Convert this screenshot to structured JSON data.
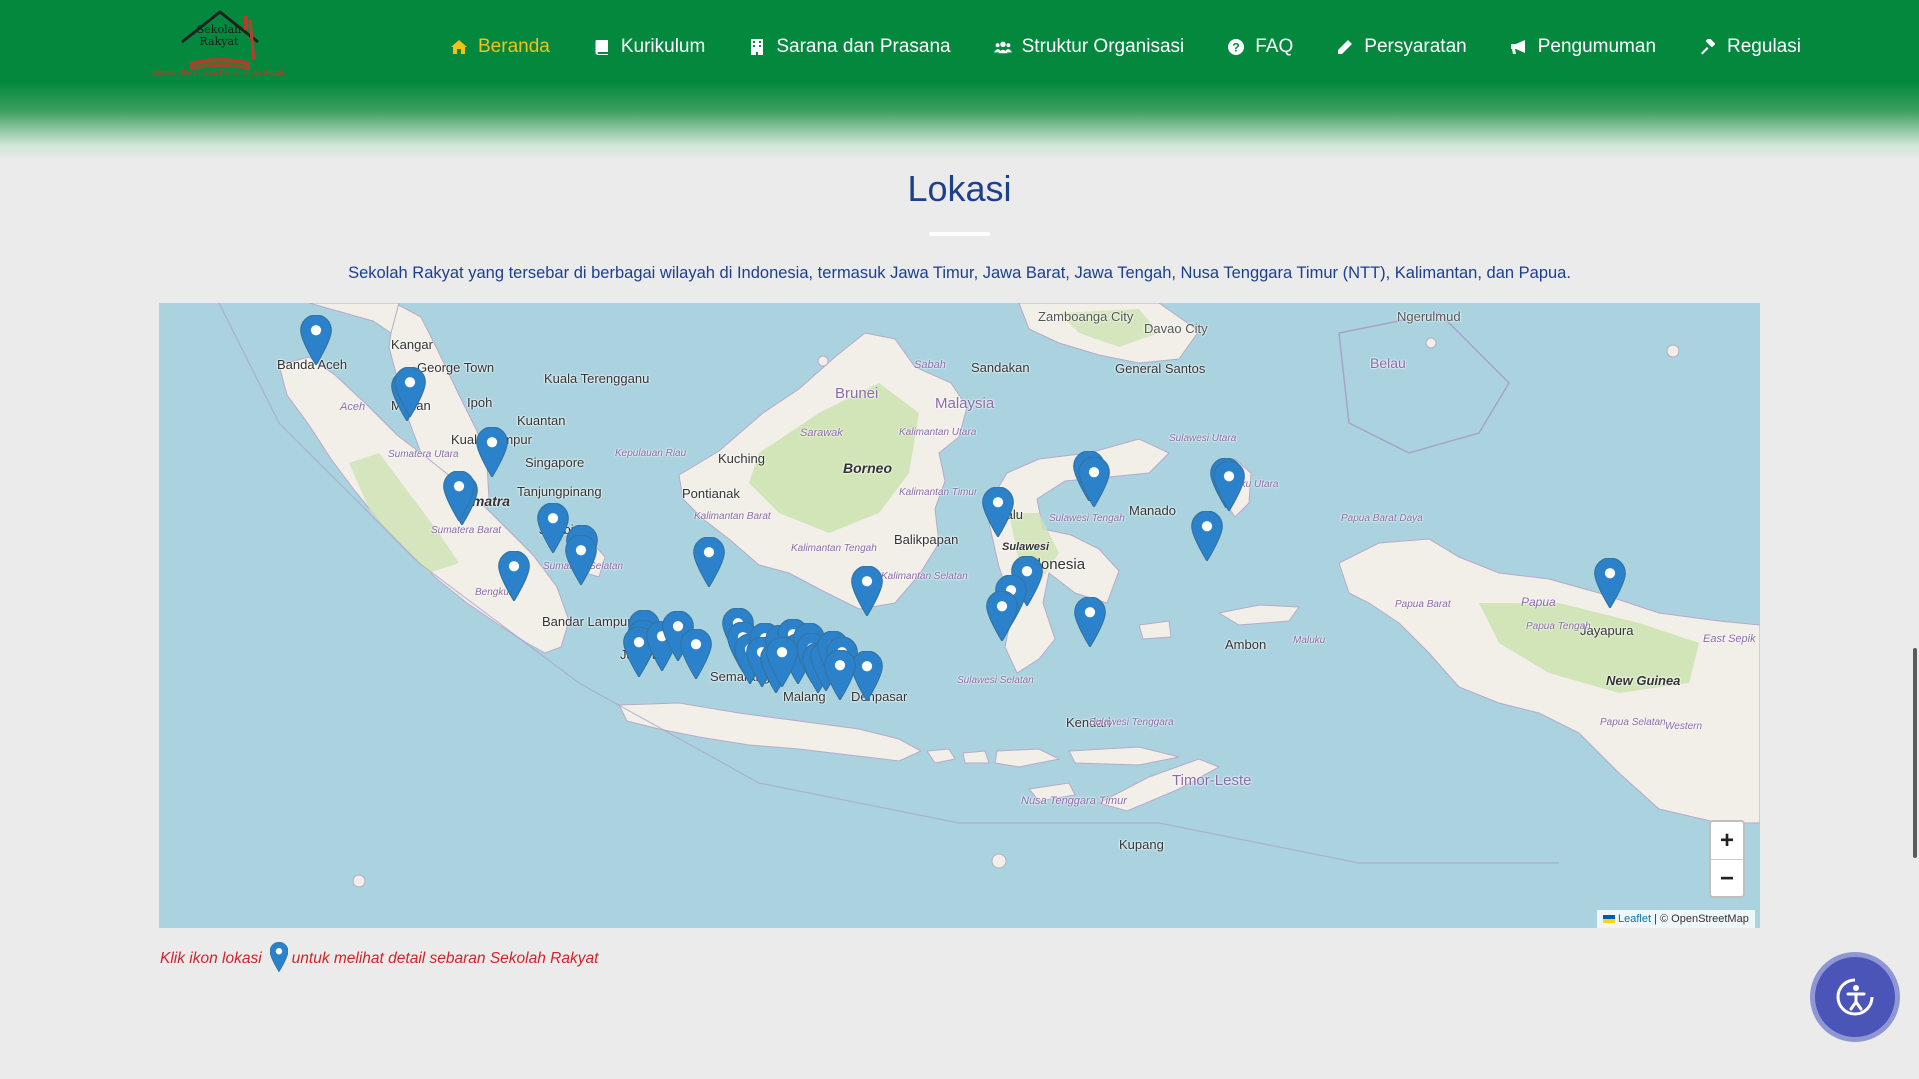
{
  "logo": {
    "title_line1": "Sekolah",
    "title_line2": "Rakyat",
    "tagline": "Sekolah Berasrama Kementerian Sosial"
  },
  "nav": {
    "items": [
      {
        "label": "Beranda",
        "icon": "home-icon",
        "active": true
      },
      {
        "label": "Kurikulum",
        "icon": "book-icon",
        "active": false
      },
      {
        "label": "Sarana dan Prasana",
        "icon": "building-icon",
        "active": false
      },
      {
        "label": "Struktur Organisasi",
        "icon": "users-icon",
        "active": false
      },
      {
        "label": "FAQ",
        "icon": "question-circle-icon",
        "active": false
      },
      {
        "label": "Persyaratan",
        "icon": "pencil-icon",
        "active": false
      },
      {
        "label": "Pengumuman",
        "icon": "megaphone-icon",
        "active": false
      },
      {
        "label": "Regulasi",
        "icon": "gavel-icon",
        "active": false
      }
    ]
  },
  "section": {
    "title": "Lokasi",
    "description": "Sekolah Rakyat yang tersebar di berbagai wilayah di Indonesia, termasuk Jawa Timur, Jawa Barat, Jawa Tengah, Nusa Tenggara Timur (NTT), Kalimantan, dan Papua."
  },
  "map": {
    "labels": [
      "Zamboanga City",
      "Davao City",
      "Ngerulmud",
      "Kangar",
      "George Town",
      "Kuala Terengganu",
      "Ipoh",
      "Kuantan",
      "Kuala Lumpur",
      "Singapore",
      "Tanjungpinang",
      "Sandakan",
      "Sabah",
      "General Santos",
      "Belau",
      "Brunei",
      "Malaysia",
      "Sarawak",
      "Kalimantan Utara",
      "Kuching",
      "Borneo",
      "Pontianak",
      "Kalimantan Timur",
      "Kalimantan Barat",
      "Balikpapan",
      "Kalimantan Tengah",
      "Kalimantan Selatan",
      "Banda Aceh",
      "Aceh",
      "Medan",
      "Sumatera Utara",
      "Kepulauan Riau",
      "Sumatra",
      "Sumatera Barat",
      "Jambi",
      "Sumatera Selatan",
      "Bengkulu",
      "Bandar Lampung",
      "Jakarta",
      "Semarang",
      "Malang",
      "Denpasar",
      "Manado",
      "Sulawesi Utara",
      "Maluku Utara",
      "Palu",
      "Sulawesi Tengah",
      "Sulawesi",
      "Indonesia",
      "Sulawesi Selatan",
      "Kendari",
      "Sulawesi Tenggara",
      "Ambon",
      "Maluku",
      "Papua Barat Daya",
      "Papua Barat",
      "Papua",
      "Jayapura",
      "Papua Tengah",
      "East Sepik",
      "New Guinea",
      "Papua Selatan",
      "Western",
      "Nusa Tenggara Timur",
      "Timor-Leste",
      "Kupang"
    ],
    "marker_count": 47,
    "marker_color": "#2b82cb",
    "zoom_in": "+",
    "zoom_out": "−",
    "attribution_leaflet": "Leaflet",
    "attribution_osm": "| © OpenStreetMap"
  },
  "note": {
    "before": "Klik ikon lokasi",
    "after": "untuk melihat detail sebaran Sekolah Rakyat"
  },
  "accessibility_button": {
    "icon": "accessibility-icon"
  },
  "colors": {
    "nav_bg": "#04883e",
    "nav_active": "#f2c21b",
    "title": "#1c3f8e",
    "note": "#d2232a",
    "water": "#aad3df",
    "land": "#f2efe9",
    "forest": "#cde3b4"
  }
}
